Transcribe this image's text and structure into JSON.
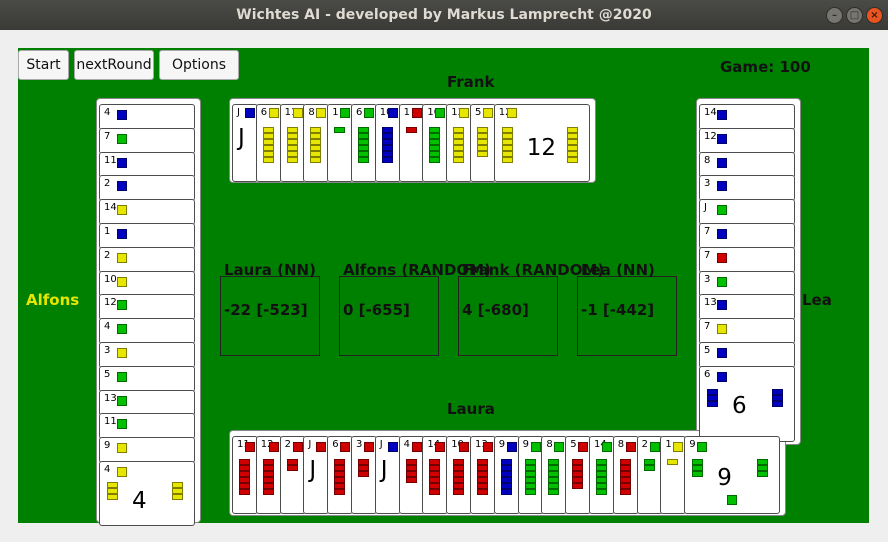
{
  "window": {
    "title": "Wichtes AI - developed by Markus Lamprecht @2020"
  },
  "toolbar": {
    "start_label": "Start",
    "next_round_label": "nextRound",
    "options_label": "Options"
  },
  "game_label": "Game: 100",
  "players": {
    "top": "Frank",
    "left": "Alfons",
    "right": "Lea",
    "bottom": "Laura"
  },
  "colors": {
    "table": "#008000",
    "blue": "#0000c0",
    "green": "#00c000",
    "yellow": "#e6e600",
    "red": "#d00000",
    "alfons_name": "#e6e600"
  },
  "scores": [
    {
      "name": "Laura (NN)",
      "value": "-22 [-523]"
    },
    {
      "name": "Alfons (RANDOM)",
      "value": "0 [-655]"
    },
    {
      "name": "Frank (RANDOM)",
      "value": "4 [-680]"
    },
    {
      "name": "Lea (NN)",
      "value": "-1 [-442]"
    }
  ],
  "hands": {
    "frank": [
      {
        "value": "J",
        "suit": "blue"
      },
      {
        "value": "6",
        "suit": "yellow"
      },
      {
        "value": "11",
        "suit": "yellow"
      },
      {
        "value": "8",
        "suit": "yellow"
      },
      {
        "value": "1",
        "suit": "green"
      },
      {
        "value": "6",
        "suit": "green"
      },
      {
        "value": "10",
        "suit": "blue"
      },
      {
        "value": "1",
        "suit": "red"
      },
      {
        "value": "10",
        "suit": "green"
      },
      {
        "value": "13",
        "suit": "yellow"
      },
      {
        "value": "5",
        "suit": "yellow"
      },
      {
        "value": "12",
        "suit": "yellow"
      }
    ],
    "alfons": [
      {
        "value": "4",
        "suit": "blue"
      },
      {
        "value": "7",
        "suit": "green"
      },
      {
        "value": "11",
        "suit": "blue"
      },
      {
        "value": "2",
        "suit": "blue"
      },
      {
        "value": "14",
        "suit": "yellow"
      },
      {
        "value": "1",
        "suit": "blue"
      },
      {
        "value": "2",
        "suit": "yellow"
      },
      {
        "value": "10",
        "suit": "yellow"
      },
      {
        "value": "12",
        "suit": "green"
      },
      {
        "value": "4",
        "suit": "green"
      },
      {
        "value": "3",
        "suit": "yellow"
      },
      {
        "value": "5",
        "suit": "green"
      },
      {
        "value": "13",
        "suit": "green"
      },
      {
        "value": "11",
        "suit": "green"
      },
      {
        "value": "9",
        "suit": "yellow"
      },
      {
        "value": "4",
        "suit": "yellow"
      }
    ],
    "lea": [
      {
        "value": "14",
        "suit": "blue"
      },
      {
        "value": "12",
        "suit": "blue"
      },
      {
        "value": "8",
        "suit": "blue"
      },
      {
        "value": "3",
        "suit": "blue"
      },
      {
        "value": "J",
        "suit": "green"
      },
      {
        "value": "7",
        "suit": "blue"
      },
      {
        "value": "7",
        "suit": "red"
      },
      {
        "value": "3",
        "suit": "green"
      },
      {
        "value": "13",
        "suit": "blue"
      },
      {
        "value": "7",
        "suit": "yellow"
      },
      {
        "value": "5",
        "suit": "blue"
      },
      {
        "value": "6",
        "suit": "blue"
      }
    ],
    "laura": [
      {
        "value": "11",
        "suit": "red"
      },
      {
        "value": "12",
        "suit": "red"
      },
      {
        "value": "2",
        "suit": "red"
      },
      {
        "value": "J",
        "suit": "red"
      },
      {
        "value": "6",
        "suit": "red"
      },
      {
        "value": "3",
        "suit": "red"
      },
      {
        "value": "J",
        "suit": "blue"
      },
      {
        "value": "4",
        "suit": "red"
      },
      {
        "value": "14",
        "suit": "red"
      },
      {
        "value": "10",
        "suit": "red"
      },
      {
        "value": "13",
        "suit": "red"
      },
      {
        "value": "9",
        "suit": "blue"
      },
      {
        "value": "9",
        "suit": "green"
      },
      {
        "value": "8",
        "suit": "green"
      },
      {
        "value": "5",
        "suit": "red"
      },
      {
        "value": "14",
        "suit": "green"
      },
      {
        "value": "8",
        "suit": "red"
      },
      {
        "value": "2",
        "suit": "green"
      },
      {
        "value": "1",
        "suit": "yellow"
      },
      {
        "value": "9",
        "suit": "green"
      }
    ]
  }
}
